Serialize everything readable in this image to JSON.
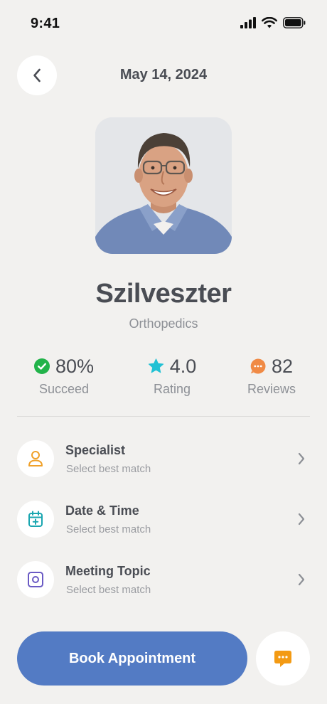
{
  "status_bar": {
    "time": "9:41"
  },
  "header": {
    "date": "May 14, 2024",
    "back_icon": "chevron-left-icon"
  },
  "doctor": {
    "photo": "doctor-portrait",
    "name": "Szilveszter",
    "specialty": "Orthopedics"
  },
  "stats": [
    {
      "value": "80%",
      "label": "Succeed",
      "icon": "check-circle-icon",
      "color": "#22b34a"
    },
    {
      "value": "4.0",
      "label": "Rating",
      "icon": "star-icon",
      "color": "#22c1d4"
    },
    {
      "value": "82",
      "label": "Reviews",
      "icon": "chat-bubble-icon",
      "color": "#f08a45"
    }
  ],
  "options": [
    {
      "title": "Specialist",
      "subtitle": "Select best match",
      "icon": "person-icon",
      "color": "#f0a12a"
    },
    {
      "title": "Date & Time",
      "subtitle": "Select best match",
      "icon": "calendar-icon",
      "color": "#1aa6b0"
    },
    {
      "title": "Meeting Topic",
      "subtitle": "Select best match",
      "icon": "topic-icon",
      "color": "#6a5ac4"
    }
  ],
  "actions": {
    "book_label": "Book Appointment",
    "book_color": "#537bc4",
    "chat_icon": "message-icon",
    "chat_color": "#f39a13"
  }
}
